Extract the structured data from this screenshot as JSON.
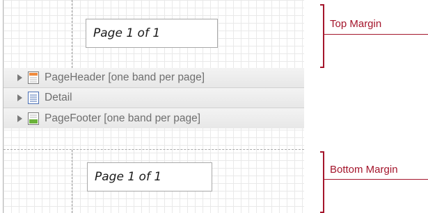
{
  "top_margin": {
    "field_text": "Page 1 of 1",
    "annotation_label": "Top Margin"
  },
  "bands": [
    {
      "label": "PageHeader [one band per page]",
      "icon": "page-header-band-icon",
      "color": "#f08a3c"
    },
    {
      "label": "Detail",
      "icon": "detail-band-icon",
      "color": "#4a6fb5"
    },
    {
      "label": "PageFooter [one band per page]",
      "icon": "page-footer-band-icon",
      "color": "#6bb33a"
    }
  ],
  "bottom_margin": {
    "field_text": "Page 1 of 1",
    "annotation_label": "Bottom Margin"
  },
  "colors": {
    "annotation": "#a4152b",
    "grid_line": "#e9e9e9",
    "band_text": "#6f6f6f"
  }
}
